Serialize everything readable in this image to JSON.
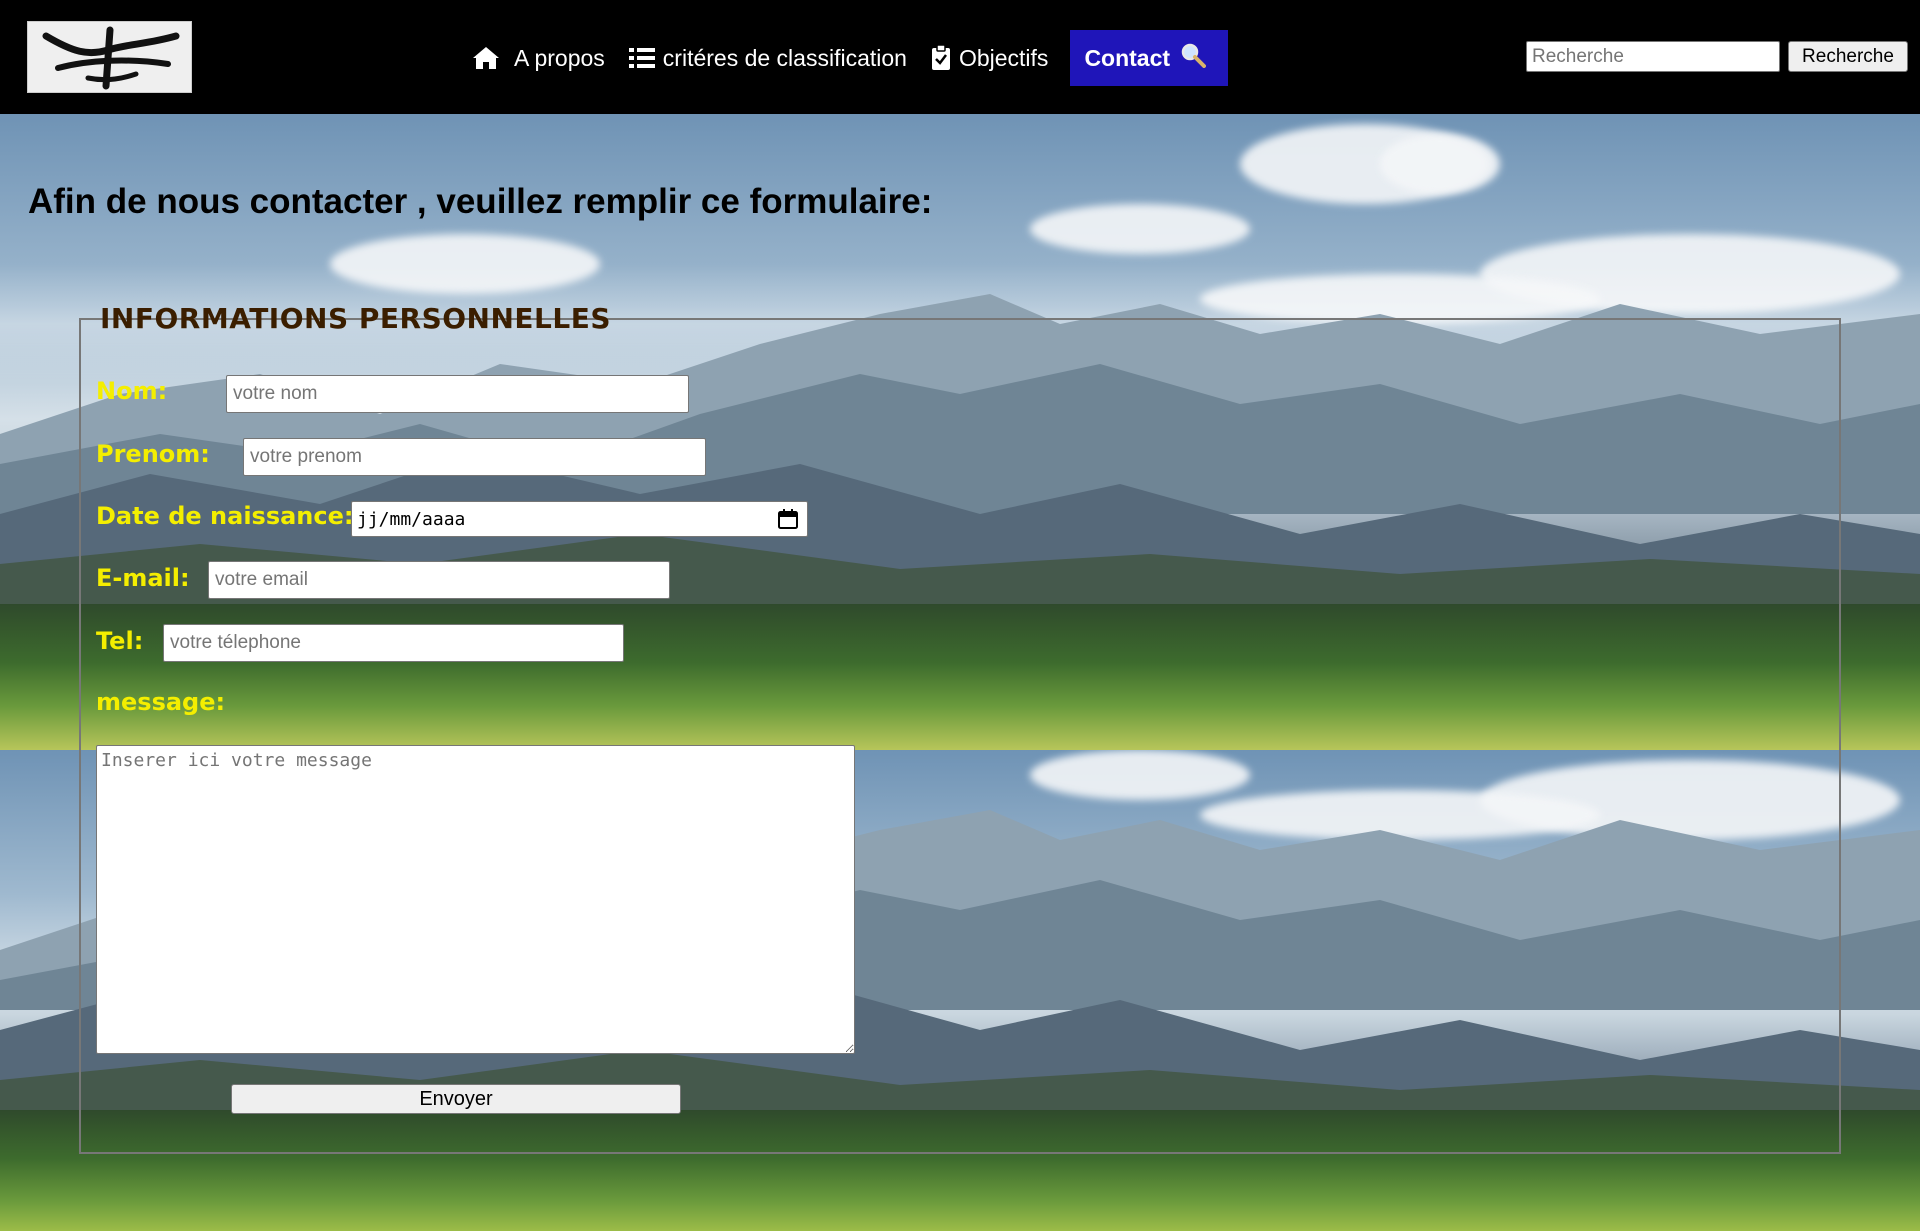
{
  "nav": {
    "items": [
      {
        "label": "A propos",
        "icon": "home-icon"
      },
      {
        "label": "critéres de classification",
        "icon": "list-icon"
      },
      {
        "label": "Objectifs",
        "icon": "clipboard-check-icon"
      },
      {
        "label": "Contact",
        "icon": "magnifier-icon"
      }
    ],
    "active_color": "#1f15b9"
  },
  "search": {
    "placeholder": "Recherche",
    "button_label": "Recherche"
  },
  "page": {
    "title": "Afin de nous contacter , veuillez remplir ce formulaire:"
  },
  "form": {
    "legend": "INFORMATIONS PERSONNELLES",
    "label_color": "#f4ee00",
    "legend_color": "#3b1e00",
    "nom": {
      "label": "Nom:",
      "placeholder": "votre nom",
      "value": ""
    },
    "prenom": {
      "label": "Prenom:",
      "placeholder": "votre prenom",
      "value": ""
    },
    "date": {
      "label": "Date de naissance:",
      "format": "jj/mm/aaaa"
    },
    "email": {
      "label": "E-mail:",
      "placeholder": "votre email",
      "value": ""
    },
    "tel": {
      "label": "Tel:",
      "placeholder": "votre télephone",
      "value": ""
    },
    "message": {
      "label": "message:",
      "placeholder": "Inserer ici votre message"
    },
    "submit_label": "Envoyer"
  }
}
